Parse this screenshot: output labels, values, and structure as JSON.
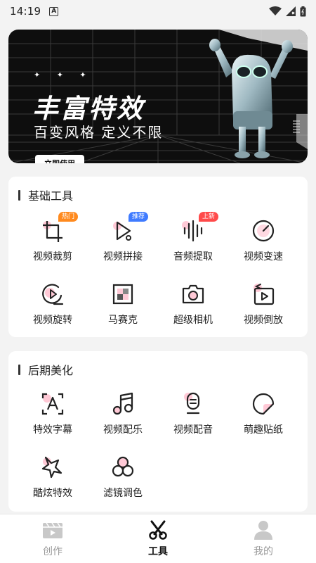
{
  "status_bar": {
    "time": "14:19",
    "a_label": "A"
  },
  "banner": {
    "stars": "✦ ✦ ✦",
    "title": "丰富特效",
    "subtitle": "百变风格 定义不限",
    "button_label": "立即使用"
  },
  "basic_tools": {
    "title": "基础工具",
    "items": [
      {
        "label": "视频裁剪",
        "icon": "crop-icon",
        "tag": "热门",
        "tag_color": "#ff8a1e"
      },
      {
        "label": "视频拼接",
        "icon": "splice-icon",
        "tag": "推荐",
        "tag_color": "#3f7bff"
      },
      {
        "label": "音频提取",
        "icon": "audio-extract-icon",
        "tag": "上新",
        "tag_color": "#ff4a4a"
      },
      {
        "label": "视频变速",
        "icon": "speed-icon"
      },
      {
        "label": "视频旋转",
        "icon": "rotate-icon"
      },
      {
        "label": "马赛克",
        "icon": "mosaic-icon"
      },
      {
        "label": "超级相机",
        "icon": "camera-icon"
      },
      {
        "label": "视频倒放",
        "icon": "reverse-icon"
      }
    ]
  },
  "post_tools": {
    "title": "后期美化",
    "items": [
      {
        "label": "特效字幕",
        "icon": "subtitle-icon"
      },
      {
        "label": "视频配乐",
        "icon": "music-icon"
      },
      {
        "label": "视频配音",
        "icon": "microphone-icon"
      },
      {
        "label": "萌趣贴纸",
        "icon": "sticker-icon"
      },
      {
        "label": "酷炫特效",
        "icon": "sparkle-icon"
      },
      {
        "label": "滤镜调色",
        "icon": "filter-icon"
      }
    ]
  },
  "bottom_nav": {
    "items": [
      {
        "label": "创作",
        "active": false
      },
      {
        "label": "工具",
        "active": true
      },
      {
        "label": "我的",
        "active": false
      }
    ]
  },
  "colors": {
    "accent_pink": "#ffc9d6",
    "active": "#111111",
    "inactive": "#9a9a9a"
  }
}
